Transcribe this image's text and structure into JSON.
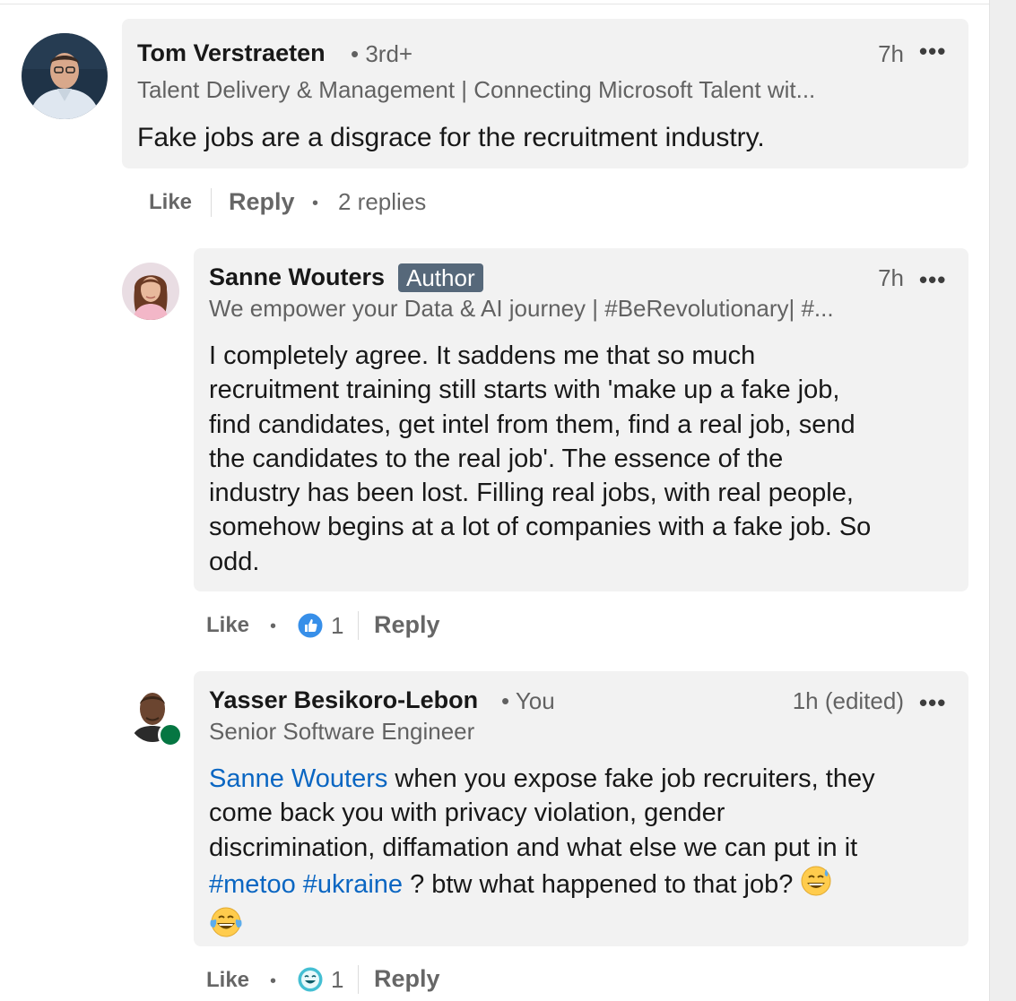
{
  "comments": [
    {
      "name": "Tom Verstraeten",
      "degree": "• 3rd+",
      "headline": "Talent Delivery & Management | Connecting Microsoft Talent wit...",
      "time": "7h",
      "more": "•••",
      "text": "Fake jobs are a disgrace for the recruitment industry.",
      "actions": {
        "like": "Like",
        "reply": "Reply",
        "replies": "2 replies"
      }
    },
    {
      "name": "Sanne Wouters",
      "badge": "Author",
      "headline": "We empower your Data & AI journey | #BeRevolutionary| #...",
      "time": "7h",
      "more": "•••",
      "text_lines": [
        "I completely agree. It saddens me that so much",
        "recruitment training still starts with 'make up a fake job,",
        "find candidates, get intel from them, find a real job, send",
        "the candidates to the real job'. The essence of the",
        "industry has been lost. Filling real jobs, with real people,",
        "somehow begins at a lot of companies with a fake job. So",
        "odd."
      ],
      "actions": {
        "like": "Like",
        "reaction_count": "1",
        "reaction_icon": "like-reaction-icon",
        "reply": "Reply"
      }
    },
    {
      "name": "Yasser Besikoro-Lebon",
      "degree": "• You",
      "headline": "Senior Software Engineer",
      "time": "1h (edited)",
      "more": "•••",
      "mention": "Sanne Wouters",
      "line1_rest": " when you expose fake job recruiters, they",
      "line2": "come back you with privacy violation, gender",
      "line3": "discrimination, diffamation and what else we can put in it",
      "hashtag1": "#metoo",
      "hashtag2": "#ukraine",
      "line4_rest": " ? btw what happened to that job? ",
      "emoji1": "grinning-sweat-emoji",
      "emoji2": "tears-of-joy-emoji",
      "actions": {
        "like": "Like",
        "reaction_count": "1",
        "reaction_icon": "funny-reaction-icon",
        "reply": "Reply"
      }
    }
  ],
  "colors": {
    "link": "#0a66c2",
    "bubble": "#f2f2f2",
    "online": "#057642",
    "badge": "#56687a"
  }
}
